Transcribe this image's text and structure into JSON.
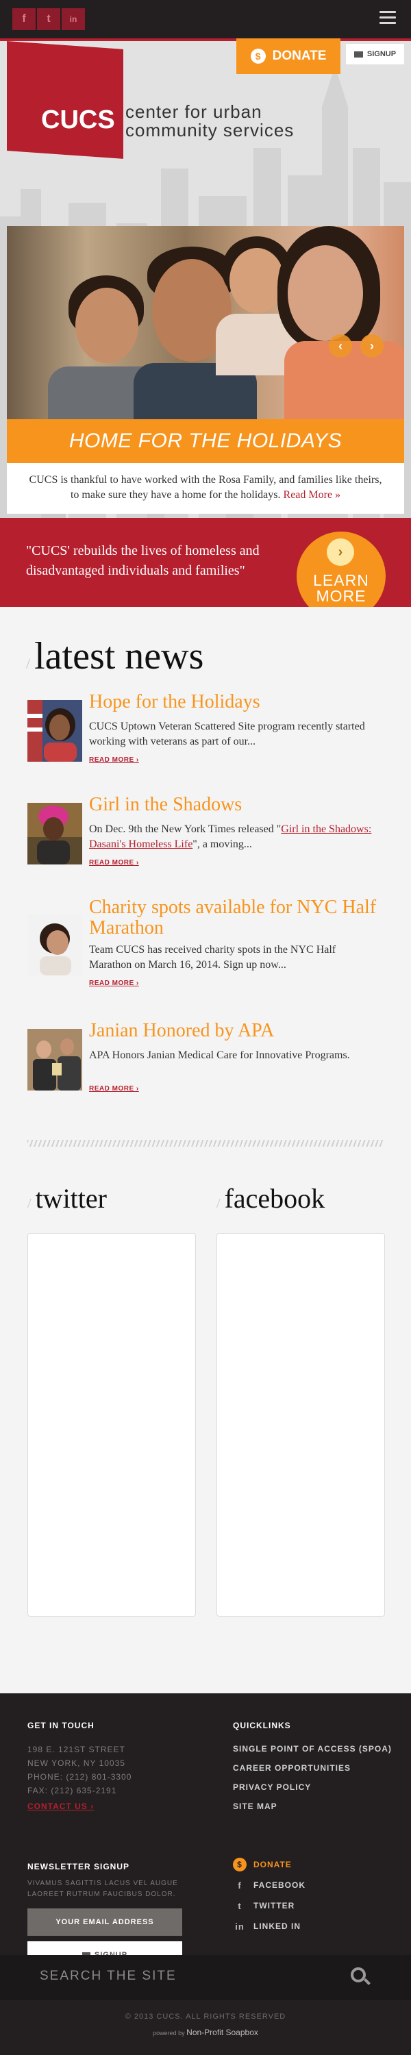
{
  "header": {
    "social": [
      "f",
      "t",
      "in"
    ],
    "donate_label": "DONATE",
    "signup_label": "SIGNUP"
  },
  "brand": {
    "logo": "CUCS",
    "tagline_1": "center for urban",
    "tagline_2": "community services"
  },
  "hero": {
    "banner": "HOME FOR THE HOLIDAYS",
    "caption": "CUCS is thankful to have worked with the Rosa Family, and families like theirs, to make sure they have a home for the holidays.",
    "read_more": "Read More »",
    "prev": "‹",
    "next": "›"
  },
  "mission": {
    "text": "\"CUCS' rebuilds the lives of homeless and disadvantaged individuals and families\"",
    "learn_1": "LEARN",
    "learn_2": "MORE",
    "chevron": "›"
  },
  "news": {
    "title": "latest news",
    "slash": "/",
    "items": [
      {
        "title": "Hope for the Holidays",
        "excerpt": "CUCS Uptown Veteran Scattered Site program recently started working with veterans as part of our...",
        "more": "READ MORE ›"
      },
      {
        "title": "Girl in the Shadows",
        "excerpt_pre": "On Dec. 9th the New York Times released \"",
        "excerpt_link": "Girl in the Shadows: Dasani's Homeless Life",
        "excerpt_post": "\", a moving...",
        "more": "READ MORE ›"
      },
      {
        "title": "Charity spots available for NYC Half Marathon",
        "excerpt": "Team CUCS has received charity spots in the NYC Half Marathon on March 16, 2014.  Sign up now...",
        "more": "READ MORE ›"
      },
      {
        "title": "Janian Honored by APA",
        "excerpt": "APA Honors Janian Medical Care for Innovative Programs.",
        "more": "READ MORE ›"
      }
    ]
  },
  "social_feeds": {
    "twitter": "twitter",
    "facebook": "facebook"
  },
  "footer": {
    "contact_heading": "GET IN TOUCH",
    "address_1": "198 E. 121ST STREET",
    "address_2": "NEW YORK, NY 10035",
    "phone": "PHONE: (212) 801-3300",
    "fax": "FAX: (212) 635-2191",
    "contact_link": "CONTACT US ›",
    "newsletter_heading": "NEWSLETTER SIGNUP",
    "newsletter_text": "VIVAMUS SAGITTIS LACUS VEL AUGUE LAOREET RUTRUM FAUCIBUS DOLOR.",
    "email_placeholder": "YOUR EMAIL ADDRESS",
    "signup": "SIGNUP",
    "quicklinks_heading": "QUICKLINKS",
    "quicklinks": [
      "SINGLE POINT OF ACCESS (SPOA)",
      "CAREER OPPORTUNITIES",
      "PRIVACY POLICY",
      "SITE MAP"
    ],
    "social_links": [
      "DONATE",
      "FACEBOOK",
      "TWITTER",
      "LINKED IN"
    ]
  },
  "search": {
    "placeholder": "SEARCH THE SITE"
  },
  "bottom": {
    "copyright": "© 2013 CUCS. ALL RIGHTS RESERVED",
    "powered_by": "powered by",
    "powered_name": "Non-Profit Soapbox"
  },
  "colors": {
    "brand_red": "#b51f2e",
    "accent_orange": "#f7941d",
    "dark": "#231f20"
  }
}
